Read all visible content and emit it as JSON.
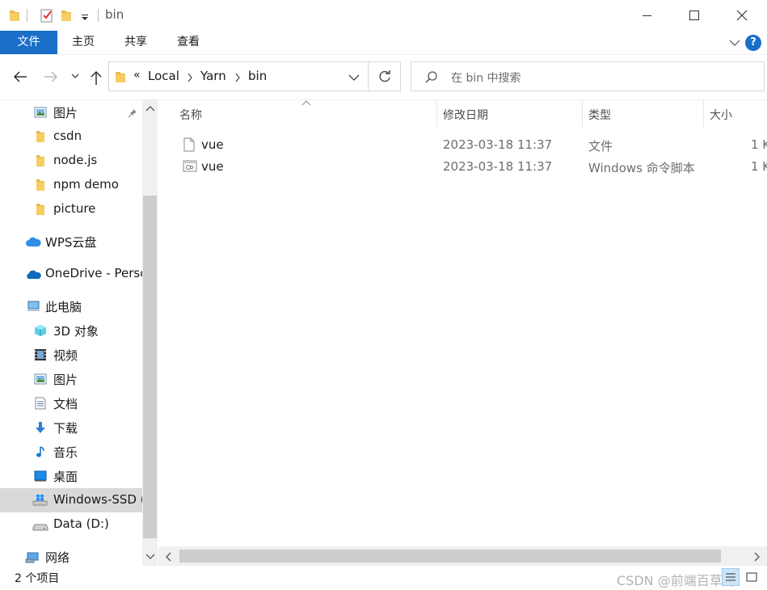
{
  "window": {
    "title": "bin"
  },
  "ribbon": {
    "tabs": [
      {
        "label": "文件"
      },
      {
        "label": "主页"
      },
      {
        "label": "共享"
      },
      {
        "label": "查看"
      }
    ]
  },
  "address": {
    "overflow": "«",
    "crumbs": [
      "Local",
      "Yarn",
      "bin"
    ]
  },
  "search": {
    "placeholder": "在 bin 中搜索"
  },
  "navpane": {
    "items": [
      {
        "label": "图片",
        "icon": "pictures-icon"
      },
      {
        "label": "csdn",
        "icon": "folder-icon"
      },
      {
        "label": "node.js",
        "icon": "folder-icon"
      },
      {
        "label": "npm demo",
        "icon": "folder-icon"
      },
      {
        "label": "picture",
        "icon": "folder-icon"
      },
      {
        "label": "WPS云盘",
        "icon": "cloud-icon"
      },
      {
        "label": "OneDrive - Perso",
        "icon": "onedrive-icon"
      },
      {
        "label": "此电脑",
        "icon": "computer-icon"
      },
      {
        "label": "3D 对象",
        "icon": "3d-objects-icon"
      },
      {
        "label": "视频",
        "icon": "video-icon"
      },
      {
        "label": "图片",
        "icon": "pictures-icon"
      },
      {
        "label": "文档",
        "icon": "documents-icon"
      },
      {
        "label": "下载",
        "icon": "download-icon"
      },
      {
        "label": "音乐",
        "icon": "music-icon"
      },
      {
        "label": "桌面",
        "icon": "desktop-icon"
      },
      {
        "label": "Windows-SSD (",
        "icon": "windows-drive-icon"
      },
      {
        "label": "Data (D:)",
        "icon": "drive-icon"
      },
      {
        "label": "网络",
        "icon": "network-icon"
      }
    ]
  },
  "files": {
    "columns": {
      "name": "名称",
      "modified": "修改日期",
      "type": "类型",
      "size": "大小"
    },
    "rows": [
      {
        "name": "vue",
        "modified": "2023-03-18 11:37",
        "type": "文件",
        "size": "1 K",
        "icon": "file-icon"
      },
      {
        "name": "vue",
        "modified": "2023-03-18 11:37",
        "type": "Windows 命令脚本",
        "size": "1 K",
        "icon": "script-file-icon"
      }
    ]
  },
  "status": {
    "count": "2 个项目",
    "watermark": "CSDN @前端百草阁"
  },
  "colors": {
    "accent": "#1a6fc9",
    "folder": "#e8b84a"
  }
}
